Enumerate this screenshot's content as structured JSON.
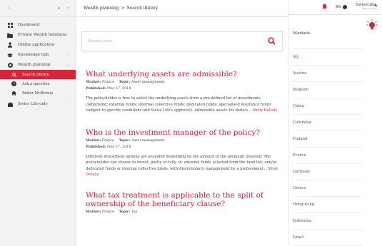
{
  "colors": {
    "accent": "#d3283a",
    "sidebar_bg": "#f2f2f2"
  },
  "sidebar": {
    "select_value": "1",
    "items": [
      {
        "label": "Dashboard",
        "icon": "dashboard-icon"
      },
      {
        "label": "Private Wealth Solutions",
        "icon": "folder-icon"
      },
      {
        "label": "Online application",
        "icon": "person-icon"
      },
      {
        "label": "Knowledge hub",
        "icon": "graduation-icon",
        "has_children": true
      },
      {
        "label": "Wealth planning",
        "icon": "lifebuoy-icon",
        "has_children": true,
        "expanded": true
      },
      {
        "label": "Swiss Life only",
        "icon": "shield-icon",
        "has_children": true
      }
    ],
    "sub_items": [
      {
        "label": "Search library",
        "icon": "search-icon",
        "active": true
      },
      {
        "label": "Ask a question",
        "icon": "question-icon"
      },
      {
        "label": "Rober McBernie",
        "icon": "home-icon"
      }
    ]
  },
  "header": {
    "breadcrumb_root": "Wealth planning",
    "breadcrumb_sep": ">",
    "breadcrumb_current": "Search library",
    "language": "EN",
    "logo_brand": "SwissLife",
    "logo_tag": "Swiss Life Select"
  },
  "search": {
    "placeholder": "Search here"
  },
  "articles": [
    {
      "title": "What underlying assets are admissible?",
      "market_label": "Market:",
      "market": "France",
      "topic_label": "Topic:",
      "topic": "Asset management",
      "published_label": "Published:",
      "published": "May 17, 2018",
      "body": "The policyholder is free to select the underlying assets from a pre-defined list of investments comprising: external funds; internal collective funds; dedicated funds; specialised insurance funds (subject to specific conditions and Swiss Life's approval). Admissible assets for dedica...",
      "more": "Show Details"
    },
    {
      "title": "Who is the investment manager of the policy?",
      "market_label": "Market:",
      "market": "France",
      "topic_label": "Topic:",
      "topic": "Asset management",
      "published_label": "Published:",
      "published": "May 17, 2018",
      "body": "Different investment options are available depending on the amount of the premium invested. The policyholder can choose to invest, partly or fully, in: external funds selected from the fund list; and/or dedicated funds or internal collective funds, with discretionary management by a professional...",
      "more": "Show Details"
    },
    {
      "title": "What tax treatment is applicable to the split of ownership of the beneficiary clause?",
      "market_label": "Market:",
      "market": "France",
      "topic_label": "Topic:",
      "topic": "Tax"
    }
  ],
  "markets": {
    "heading": "Markets",
    "items": [
      "All",
      "Austria",
      "Belgium",
      "China",
      "Columbia",
      "Finland",
      "France",
      "Germany",
      "Greece",
      "Hong-Kong",
      "Indonesia",
      "Israel"
    ]
  }
}
